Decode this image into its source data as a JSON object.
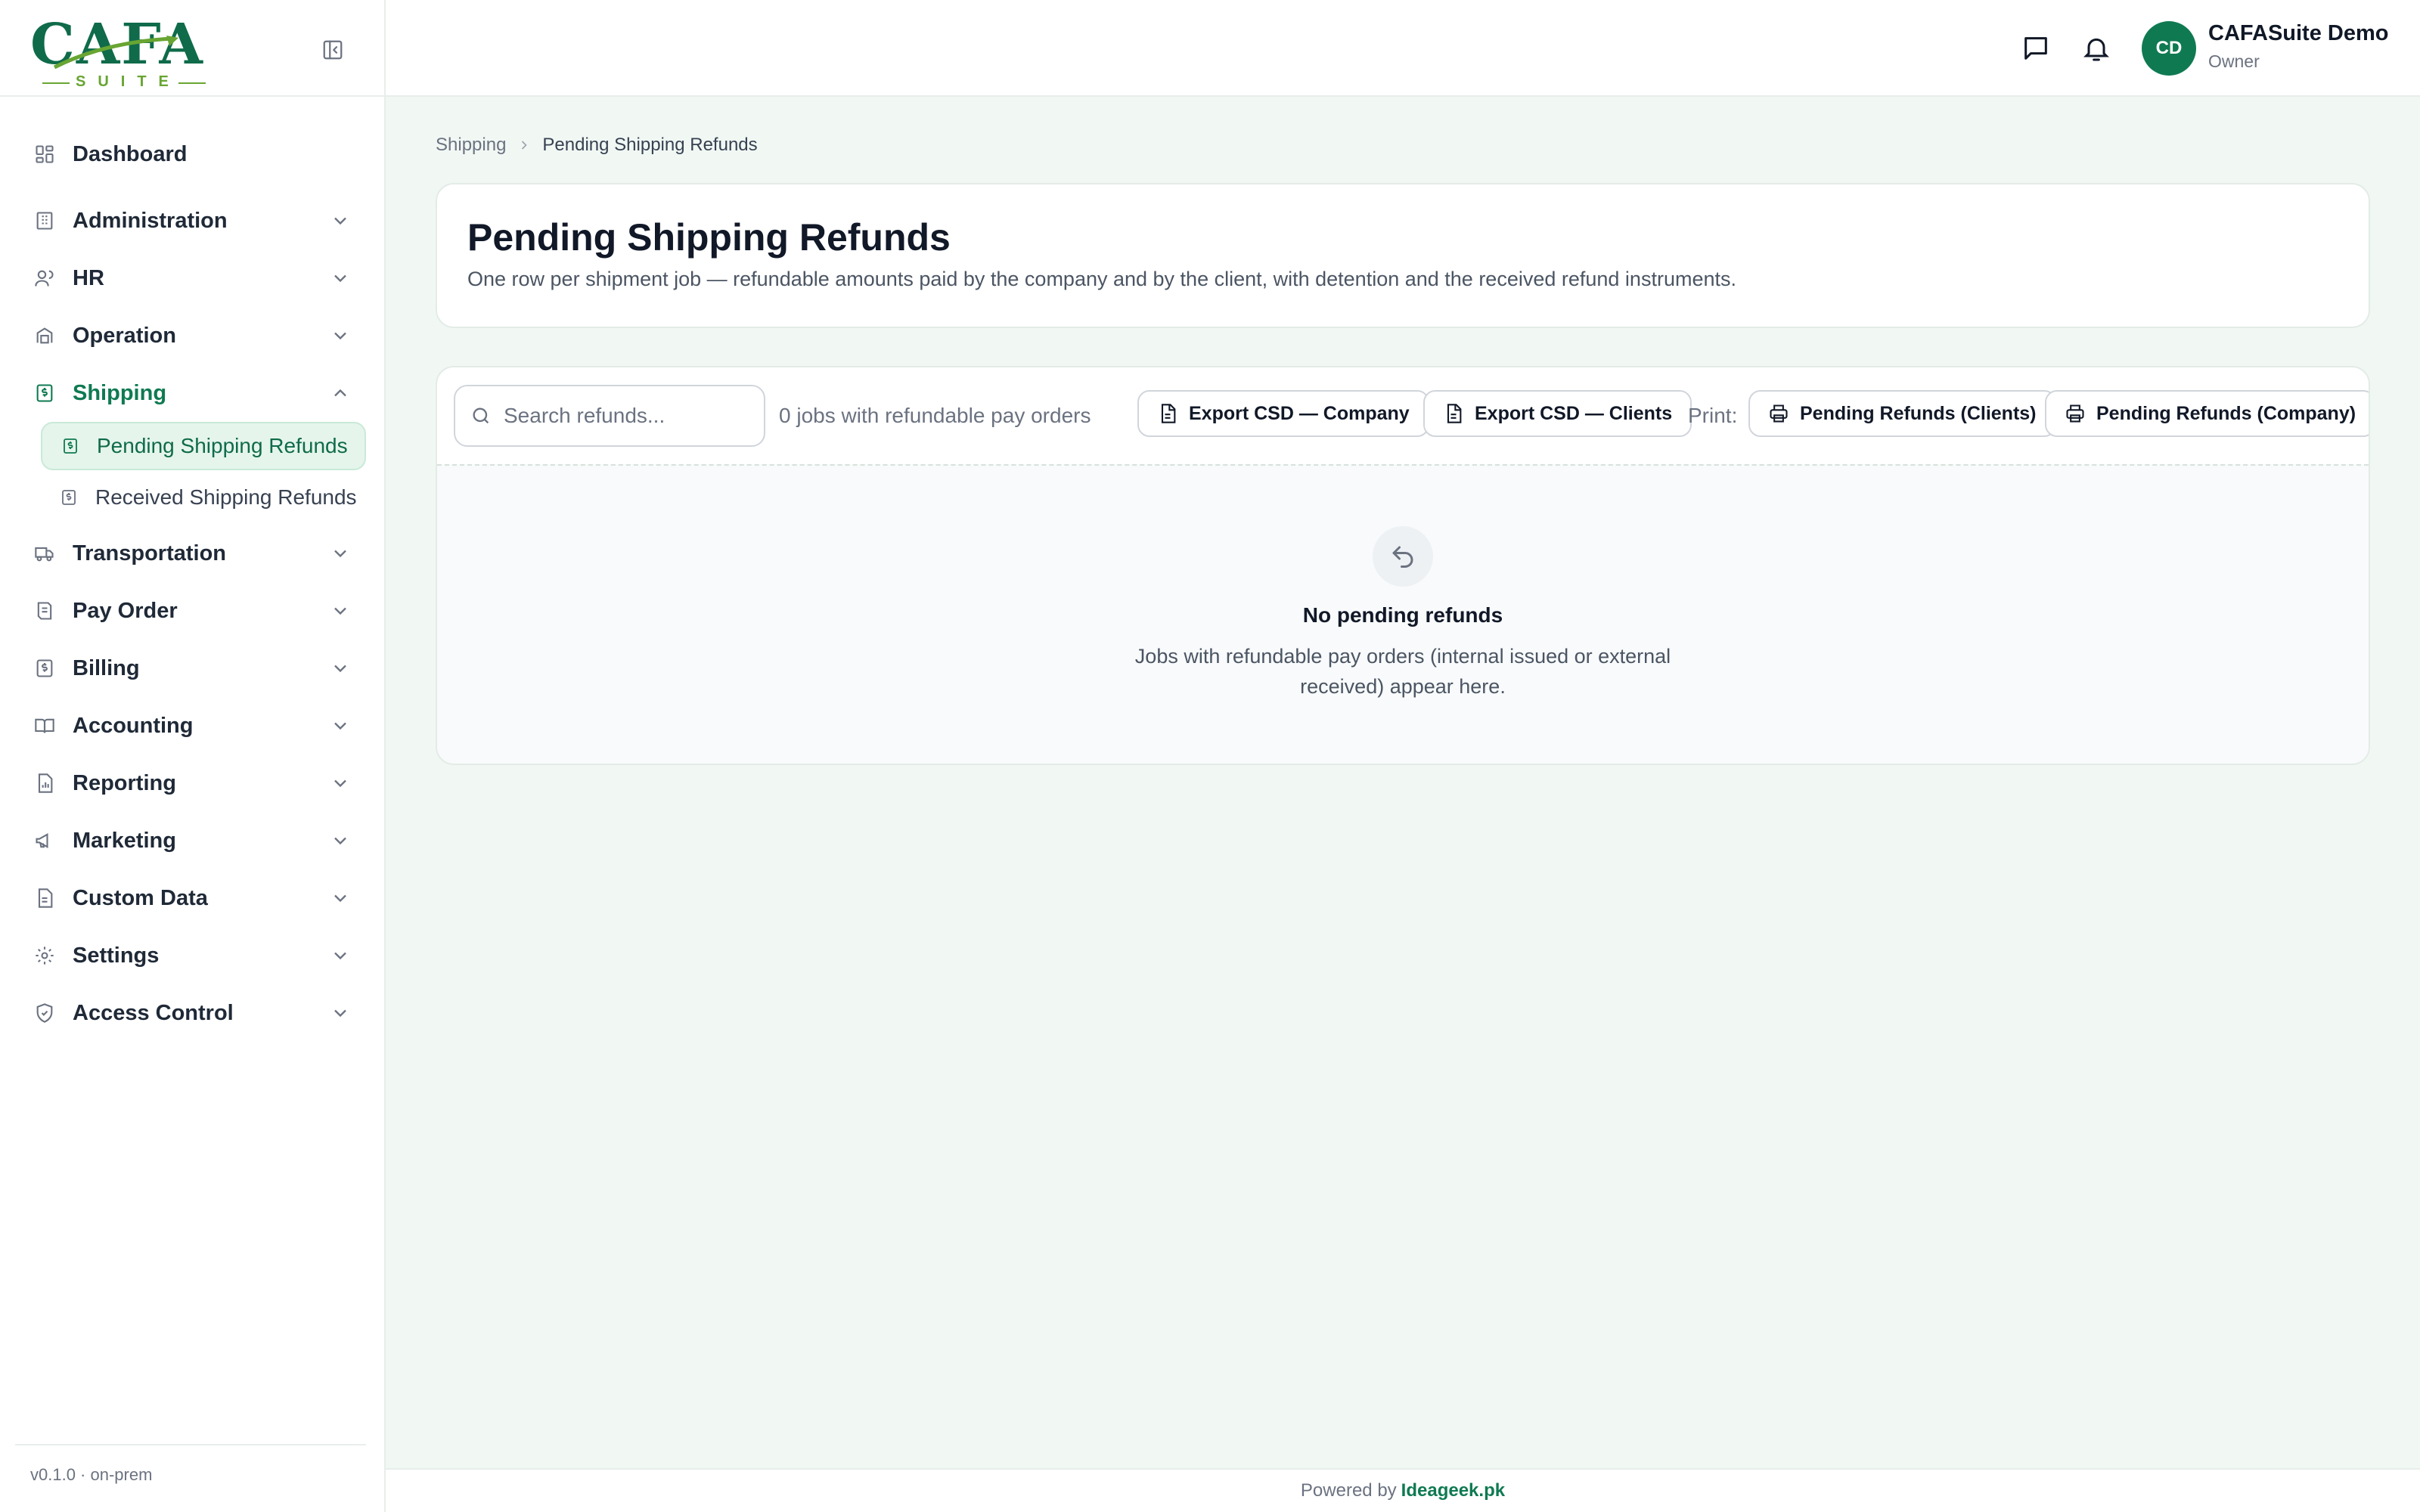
{
  "brand": {
    "logo_text": "CAFA",
    "logo_sub": "SUITE"
  },
  "sidebar": {
    "items": [
      {
        "label": "Dashboard",
        "icon": "dashboard-icon"
      },
      {
        "label": "Administration",
        "icon": "building-icon"
      },
      {
        "label": "HR",
        "icon": "users-icon"
      },
      {
        "label": "Operation",
        "icon": "operation-icon"
      },
      {
        "label": "Shipping",
        "icon": "dollar-doc-icon"
      },
      {
        "label": "Transportation",
        "icon": "truck-icon"
      },
      {
        "label": "Pay Order",
        "icon": "receipt-icon"
      },
      {
        "label": "Billing",
        "icon": "billing-icon"
      },
      {
        "label": "Accounting",
        "icon": "book-icon"
      },
      {
        "label": "Reporting",
        "icon": "report-icon"
      },
      {
        "label": "Marketing",
        "icon": "megaphone-icon"
      },
      {
        "label": "Custom Data",
        "icon": "custom-data-icon"
      },
      {
        "label": "Settings",
        "icon": "gear-icon"
      },
      {
        "label": "Access Control",
        "icon": "shield-icon"
      }
    ],
    "shipping_sub": [
      {
        "label": "Pending Shipping Refunds"
      },
      {
        "label": "Received Shipping Refunds"
      }
    ],
    "version": "v0.1.0 · on-prem"
  },
  "topbar": {
    "user_initials": "CD",
    "user_name": "CAFASuite Demo",
    "user_role": "Owner"
  },
  "breadcrumb": {
    "parent": "Shipping",
    "current": "Pending Shipping Refunds"
  },
  "header": {
    "title": "Pending Shipping Refunds",
    "description": "One row per shipment job — refundable amounts paid by the company and by the client, with detention and the received refund instruments."
  },
  "toolbar": {
    "search_placeholder": "Search refunds...",
    "count_text": "0 jobs with refundable pay orders",
    "export_company": "Export CSD — Company",
    "export_clients": "Export CSD — Clients",
    "print_label": "Print:",
    "print_clients": "Pending Refunds (Clients)",
    "print_company": "Pending Refunds (Company)"
  },
  "empty": {
    "title": "No pending refunds",
    "description": "Jobs with refundable pay orders (internal issued or external received) appear here."
  },
  "footer": {
    "prefix": "Powered by",
    "link": "Ideageek.pk"
  },
  "colors": {
    "accent": "#0f7a52",
    "logo_green": "#68a532",
    "background": "#f1f8f4"
  }
}
